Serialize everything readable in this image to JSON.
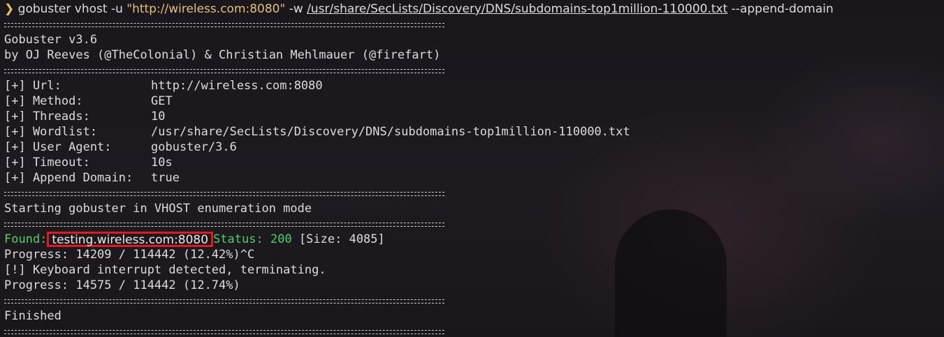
{
  "terminal": {
    "command": {
      "prompt_symbol": "❯",
      "binary": "gobuster",
      "subcommand": "vhost",
      "url_flag": "-u",
      "url": "\"http://wireless.com:8080\"",
      "wordlist_flag": "-w",
      "wordlist": "/usr/share/SecLists/Discovery/DNS/subdomains-top1million-110000.txt",
      "extra_flag": "--append-domain"
    },
    "banner": {
      "title": "Gobuster v3.6",
      "authors": "by OJ Reeves (@TheColonial) & Christian Mehlmauer (@firefart)"
    },
    "config": [
      {
        "label": "[+] Url:",
        "value": "http://wireless.com:8080"
      },
      {
        "label": "[+] Method:",
        "value": "GET"
      },
      {
        "label": "[+] Threads:",
        "value": "10"
      },
      {
        "label": "[+] Wordlist:",
        "value": "/usr/share/SecLists/Discovery/DNS/subdomains-top1million-110000.txt"
      },
      {
        "label": "[+] User Agent:",
        "value": "gobuster/3.6"
      },
      {
        "label": "[+] Timeout:",
        "value": "10s"
      },
      {
        "label": "[+] Append Domain:",
        "value": "true"
      }
    ],
    "mode_line": "Starting gobuster in VHOST enumeration mode",
    "result": {
      "found_label": "Found:",
      "host": "testing.wireless.com:8080",
      "status_label": "Status:",
      "status_code": "200",
      "size": "[Size: 4085]"
    },
    "progress_1": "Progress: 14209 / 114442 (12.42%)^C",
    "interrupt": "[!] Keyboard interrupt detected, terminating.",
    "progress_2": "Progress: 14575 / 114442 (12.74%)",
    "finished": "Finished",
    "colors": {
      "prompt": "#e8c547",
      "string": "#e5c07b",
      "found": "#4fd16b",
      "highlight_box": "#e11b1b"
    }
  }
}
